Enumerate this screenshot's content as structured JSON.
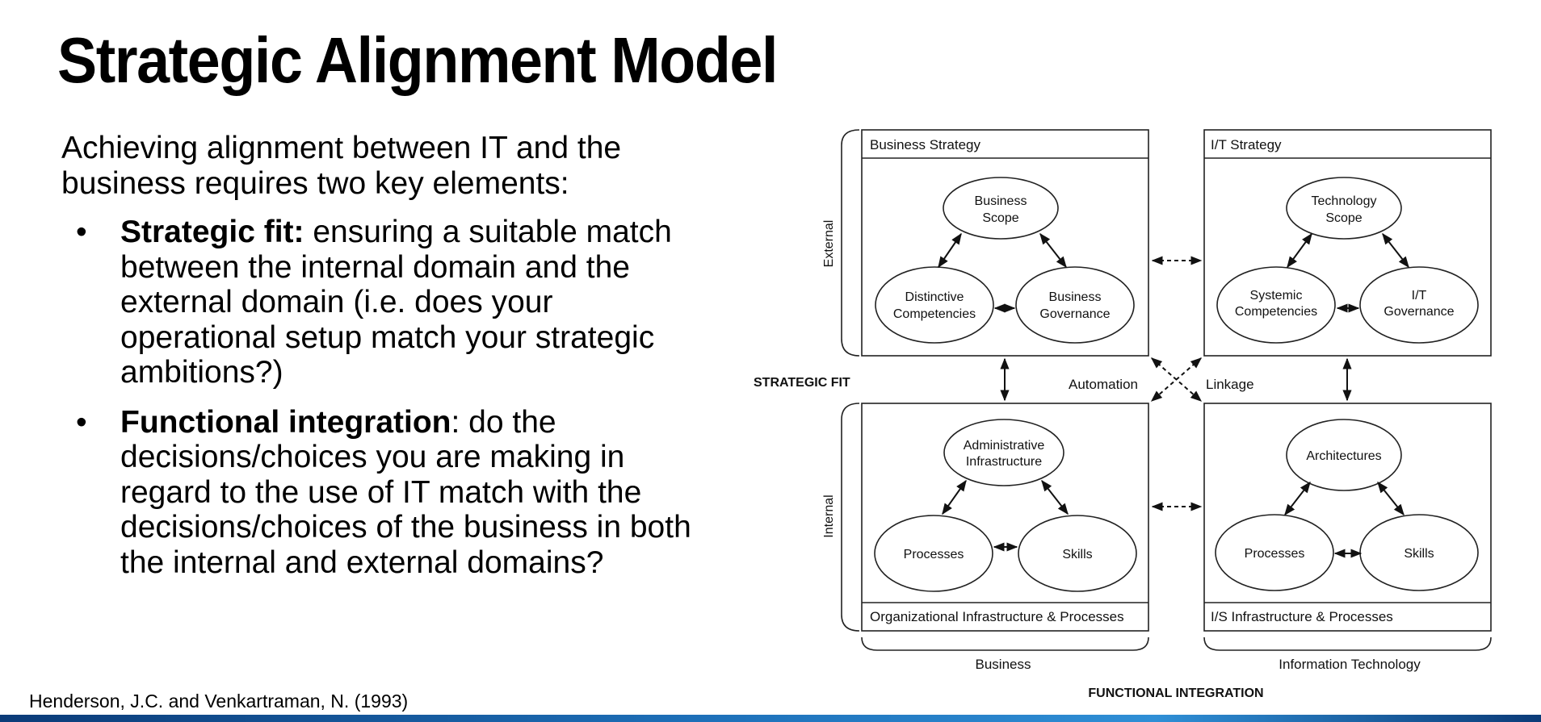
{
  "slide": {
    "title": "Strategic Alignment Model",
    "intro": "Achieving alignment between IT and the business requires two key elements:",
    "bullets": [
      {
        "marker": "•",
        "term": "Strategic fit:",
        "text": " ensuring a suitable match between the internal domain and the external domain (i.e. does your operational setup match your strategic ambitions?)"
      },
      {
        "marker": "•",
        "term": "Functional integration",
        "text": ": do the decisions/choices you are making in regard to the use of IT match with the decisions/choices of the business in both the internal and external domains?"
      }
    ],
    "citation": "Henderson, J.C. and Venkartraman, N. (1993)"
  },
  "diagram": {
    "quadrants": {
      "business_strategy": {
        "label": "Business Strategy",
        "top": [
          "Business",
          "Scope"
        ],
        "left": [
          "Distinctive",
          "Competencies"
        ],
        "right": [
          "Business",
          "Governance"
        ]
      },
      "it_strategy": {
        "label": "I/T Strategy",
        "top": [
          "Technology",
          "Scope"
        ],
        "left": [
          "Systemic",
          "Competencies"
        ],
        "right": [
          "I/T",
          "Governance"
        ]
      },
      "org_infrastructure": {
        "label": "Organizational Infrastructure & Processes",
        "top": [
          "Administrative",
          "Infrastructure"
        ],
        "left": "Processes",
        "right": "Skills"
      },
      "is_infrastructure": {
        "label": "I/S Infrastructure & Processes",
        "top": "Architectures",
        "left": "Processes",
        "right": "Skills"
      }
    },
    "side_labels": {
      "external": "External",
      "internal": "Internal"
    },
    "strategic_fit": "STRATEGIC FIT",
    "automation": "Automation",
    "linkage": "Linkage",
    "bottom_labels": {
      "business": "Business",
      "it": "Information Technology"
    },
    "functional_integration": "FUNCTIONAL INTEGRATION"
  },
  "colors": {
    "bottom_bar": "#1d6fb8",
    "text": "#000000"
  }
}
